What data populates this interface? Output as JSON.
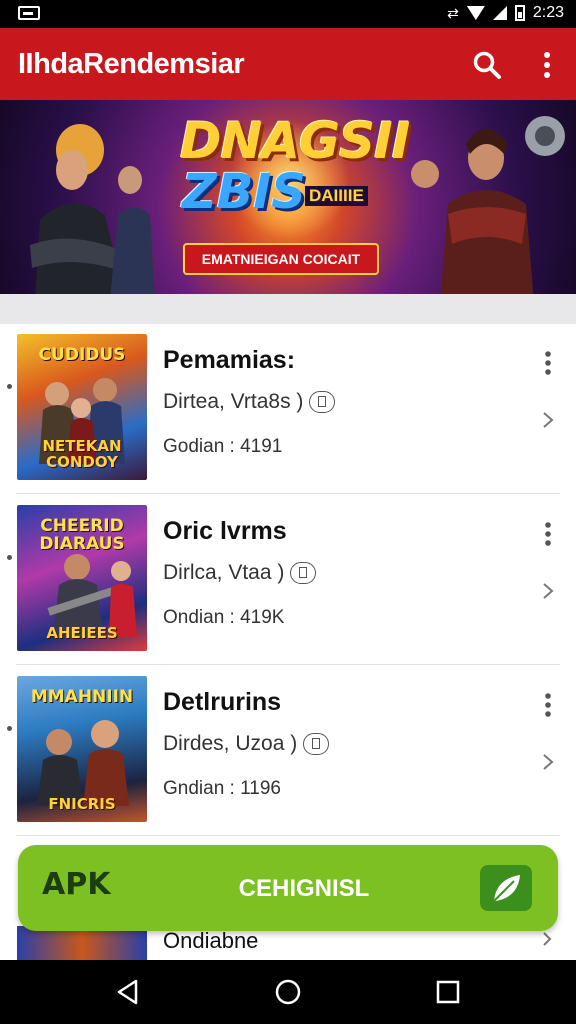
{
  "status_bar": {
    "time": "2:23"
  },
  "app_bar": {
    "title": "IIhdaRendemsiar",
    "icons": [
      "search-icon",
      "more-vert-icon"
    ]
  },
  "banner": {
    "logo_line1": "DNAGSII",
    "logo_line2": "ZBIS",
    "logo_tag": "DAIIIIE",
    "cta": "EMATNIEIGAN COICAIT"
  },
  "list": [
    {
      "name": "Pemamias:",
      "subtitle": "Dirtea, Vrta8s )",
      "count": "Godian : 4191",
      "thumb_top": "CUDIDUS",
      "thumb_bottom": "NETEKAN CONDOY",
      "colors": [
        "#e8a21c",
        "#2a6cc8",
        "#7a1f1f"
      ]
    },
    {
      "name": "Oric lvrms",
      "subtitle": "Dirlca, Vtaa )",
      "count": "Ondian : 419K",
      "thumb_top": "CHEERID DIARAUS",
      "thumb_bottom": "AHEIEES",
      "colors": [
        "#b03aa8",
        "#1c2f80",
        "#e13b3b"
      ]
    },
    {
      "name": "Detlrurins",
      "subtitle": "Dirdes, Uzoa )",
      "count": "Gndian : 1196",
      "thumb_top": "MMAHNIIN",
      "thumb_bottom": "FNICRIS",
      "colors": [
        "#2c7ac0",
        "#1b2340",
        "#c4552a"
      ]
    }
  ],
  "peek_item": {
    "name": "Ondiabne"
  },
  "apk_bar": {
    "logo": "APK",
    "label": "CEHIGNISL",
    "colors": {
      "background": "#7cc021"
    }
  },
  "nav_bar": {
    "icons": [
      "back-icon",
      "home-icon",
      "recents-icon"
    ]
  }
}
